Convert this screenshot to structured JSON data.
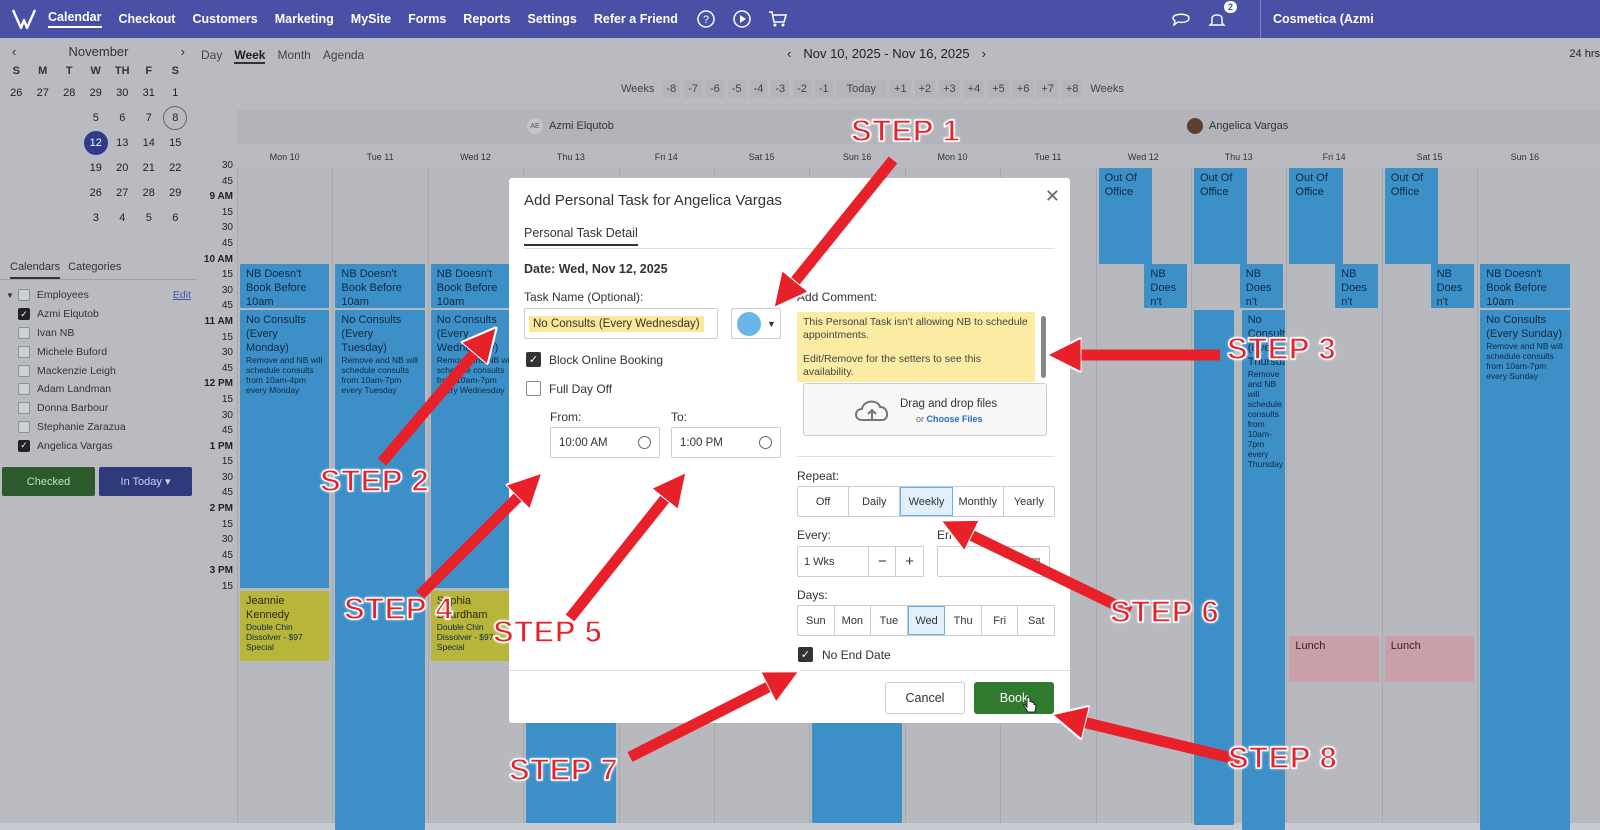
{
  "topnav": {
    "items": [
      "Calendar",
      "Checkout",
      "Customers",
      "Marketing",
      "MySite",
      "Forms",
      "Reports",
      "Settings",
      "Refer a Friend"
    ],
    "notifications": "2",
    "business": "Cosmetica (Azmi"
  },
  "minical": {
    "month": "November",
    "day_headers": [
      "S",
      "M",
      "T",
      "W",
      "TH",
      "F",
      "S"
    ],
    "weeks": [
      [
        "26",
        "27",
        "28",
        "29",
        "30",
        "31",
        "1"
      ],
      [
        "",
        "",
        "",
        "5",
        "6",
        "7",
        "8"
      ],
      [
        "",
        "",
        "",
        "12",
        "13",
        "14",
        "15"
      ],
      [
        "",
        "",
        "",
        "19",
        "20",
        "21",
        "22"
      ],
      [
        "",
        "",
        "",
        "26",
        "27",
        "28",
        "29"
      ],
      [
        "",
        "",
        "",
        "3",
        "4",
        "5",
        "6"
      ]
    ]
  },
  "sidebar": {
    "tabs": [
      "Calendars",
      "Categories"
    ],
    "group": "Employees",
    "edit": "Edit",
    "employees": [
      {
        "name": "Azmi Elqutob",
        "checked": true
      },
      {
        "name": "Ivan NB",
        "checked": false
      },
      {
        "name": "Michele Buford",
        "checked": false
      },
      {
        "name": "Mackenzie Leigh",
        "checked": false
      },
      {
        "name": "Adam Landman",
        "checked": false
      },
      {
        "name": "Donna Barbour",
        "checked": false
      },
      {
        "name": "Stephanie Zarazua",
        "checked": false
      },
      {
        "name": "Angelica Vargas",
        "checked": true
      }
    ],
    "btn_checked": "Checked",
    "btn_intoday": "In Today ▾"
  },
  "toolbar": {
    "views": [
      "Day",
      "Week",
      "Month",
      "Agenda"
    ],
    "range": "Nov 10, 2025 - Nov 16, 2025",
    "hrs": "24 hrs",
    "weeks_label": "Weeks",
    "weeks_prev": [
      "-8",
      "-7",
      "-6",
      "-5",
      "-4",
      "-3",
      "-2",
      "-1"
    ],
    "today": "Today",
    "weeks_next": [
      "+1",
      "+2",
      "+3",
      "+4",
      "+5",
      "+6",
      "+7",
      "+8"
    ]
  },
  "staff": {
    "a_initials": "AE",
    "a": "Azmi Elqutob",
    "b": "Angelica Vargas"
  },
  "days": [
    "Mon 10",
    "Tue 11",
    "Wed 12",
    "Thu 13",
    "Fri 14",
    "Sat 15",
    "Sun 16",
    "Mon 10",
    "Tue 11",
    "Wed 12",
    "Thu 13",
    "Fri 14",
    "Sat 15",
    "Sun 16"
  ],
  "times": [
    "30",
    "45",
    "9 AM",
    "15",
    "30",
    "45",
    "10 AM",
    "15",
    "30",
    "45",
    "11 AM",
    "15",
    "30",
    "45",
    "12 PM",
    "15",
    "30",
    "45",
    "1 PM",
    "15",
    "30",
    "45",
    "2 PM",
    "15",
    "30",
    "45",
    "3 PM",
    "15"
  ],
  "events": {
    "nb": "NB Doesn't Book Before 10am",
    "nc_mon": "No Consults (Every Monday)",
    "nc_mon_sub": "Remove and NB will schedule consults from 10am-4pm every Monday",
    "nc_tue": "No Consults (Every Tuesday)",
    "nc_tue_sub": "Remove and NB will schedule consults from 10am-7pm every Tuesday",
    "nc_wed": "No Consults (Every Wednesday)",
    "nc_wed_sub": "Remove and NB will schedule consults from 10am-7pm every Wednesday",
    "nc_sun": "No Consults (Every Sunday)",
    "nc_sun_sub": "Remove and NB will schedule consults from 10am-7pm every Sunday",
    "ooo": "Out Of Office",
    "nb_short": "NB Does n't",
    "thu_nc": "No Consults (Every Thursday)",
    "thu_nc_sub": "Remove and NB will schedule consults from 10am-7pm every Thursday",
    "jeannie": "Jeannie Kennedy",
    "jeannie_sub": "Double Chin Dissolver - $97 Special",
    "sophia": "Sophia Beardham",
    "sophia_sub": "Double Chin Dissolver - $97 Special",
    "lunch": "Lunch"
  },
  "modal": {
    "title": "Add Personal Task for Angelica Vargas",
    "tab": "Personal Task Detail",
    "date": "Date: Wed, Nov 12, 2025",
    "task_label": "Task Name (Optional):",
    "task_value": "No Consults (Every Wednesday)",
    "block_online": "Block Online Booking",
    "full_day_off": "Full Day Off",
    "from_label": "From:",
    "from_value": "10:00 AM",
    "to_label": "To:",
    "to_value": "1:00 PM",
    "comment_label": "Add Comment:",
    "comment_1": "This Personal Task isn't allowing NB to schedule appointments.",
    "comment_2": "Edit/Remove for the setters to see this availability.",
    "drop_text": "Drag and drop files",
    "drop_or": "or",
    "drop_link": "Choose Files",
    "repeat_label": "Repeat:",
    "repeat_options": [
      "Off",
      "Daily",
      "Weekly",
      "Monthly",
      "Yearly"
    ],
    "every_label": "Every:",
    "every_value": "1  Wks",
    "end_label": "End",
    "days_label": "Days:",
    "days": [
      "Sun",
      "Mon",
      "Tue",
      "Wed",
      "Thu",
      "Fri",
      "Sat"
    ],
    "no_end_date": "No End Date",
    "cancel": "Cancel",
    "book": "Book",
    "task_color": "#6ab6ea"
  },
  "steps": [
    "STEP 1",
    "STEP 2",
    "STEP 3",
    "STEP 4",
    "STEP 5",
    "STEP 6",
    "STEP 7",
    "STEP 8"
  ],
  "colors": {
    "nav": "#4a50a6",
    "event_blue": "#3d8fc7",
    "arrow": "#e8202a",
    "book": "#2f7a2f"
  }
}
